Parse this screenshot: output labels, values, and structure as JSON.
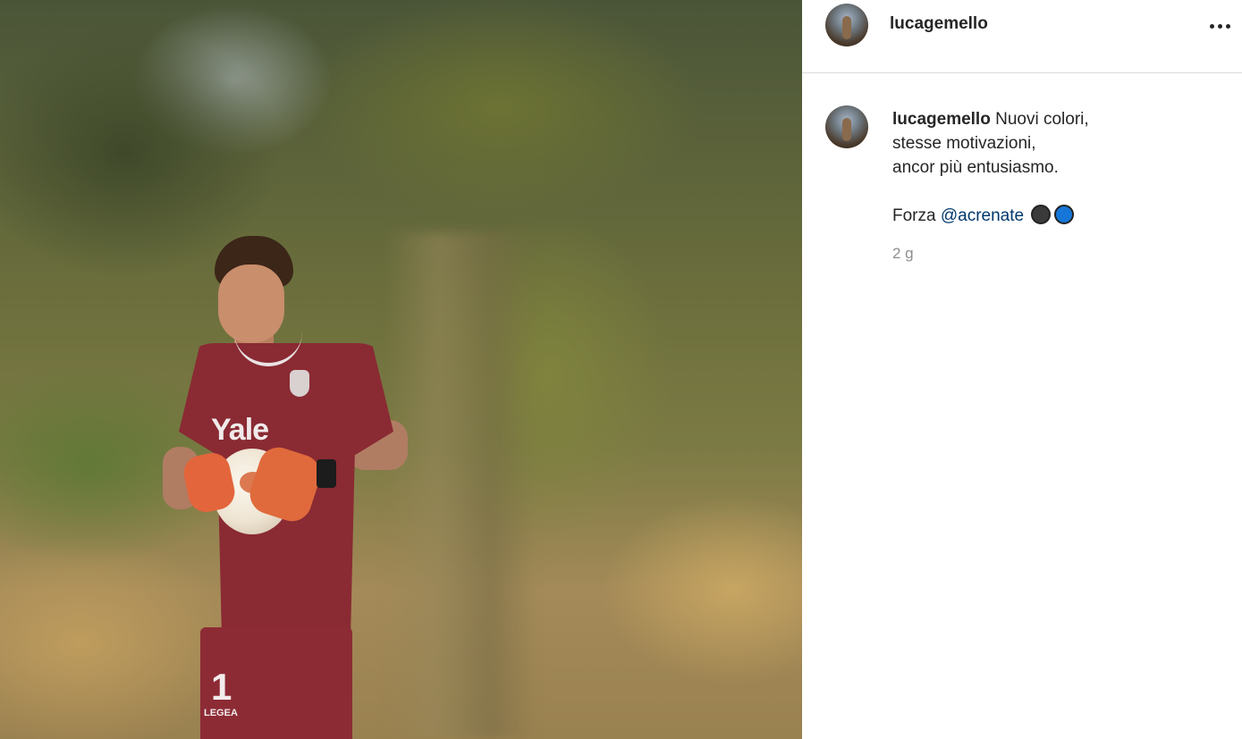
{
  "post": {
    "username": "lucagemello",
    "caption": {
      "first_line": "Nuovi colori,",
      "line2": "stesse motivazioni,",
      "line3": "ancor più entusiasmo.",
      "forza_text": "Forza",
      "mention": "@acrenate"
    },
    "timestamp": "2 g"
  },
  "photo": {
    "jersey_sponsor": "Yale",
    "jersey_number": "1",
    "shorts_brand": "LEGEA"
  },
  "icons": {
    "more": "more-options-icon",
    "heart_black": "black-heart-emoji",
    "heart_blue": "blue-heart-emoji"
  },
  "colors": {
    "mention": "#00376b",
    "heart_blue": "#1677d9",
    "heart_black": "#3a3a3a",
    "timestamp": "#8e8e8e"
  }
}
